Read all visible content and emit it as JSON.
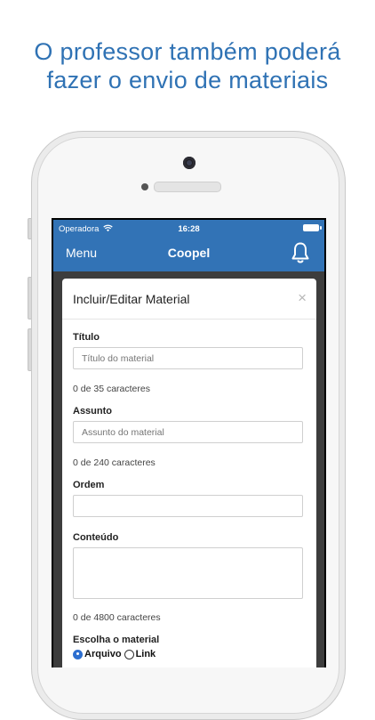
{
  "headline": {
    "line1": "O professor também poderá",
    "line2": "fazer o envio de materiais"
  },
  "status_bar": {
    "carrier": "Operadora",
    "time": "16:28"
  },
  "nav": {
    "menu_label": "Menu",
    "title": "Coopel",
    "notification_icon": "bell-icon"
  },
  "modal": {
    "title": "Incluir/Editar Material",
    "close_symbol": "×",
    "fields": {
      "titulo": {
        "label": "Título",
        "placeholder": "Título do material",
        "value": "",
        "counter": "0 de 35 caracteres"
      },
      "assunto": {
        "label": "Assunto",
        "placeholder": "Assunto do material",
        "value": "",
        "counter": "0 de 240 caracteres"
      },
      "ordem": {
        "label": "Ordem",
        "value": ""
      },
      "conteudo": {
        "label": "Conteúdo",
        "value": "",
        "counter": "0 de 4800 caracteres"
      }
    },
    "material_choice": {
      "label": "Escolha o material",
      "options": [
        "Arquivo",
        "Link"
      ],
      "selected": "Arquivo"
    }
  },
  "colors": {
    "brand_blue": "#3273b6",
    "headline_blue": "#2f72b4",
    "radio_blue": "#2d6fd0"
  }
}
